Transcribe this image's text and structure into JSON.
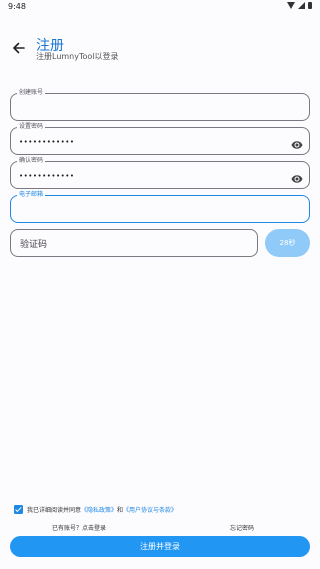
{
  "status_bar": {
    "time": "9:48"
  },
  "header": {
    "title": "注册",
    "subtitle": "注册LumnyTool以登录"
  },
  "form": {
    "account_label": "创建账号",
    "account_value": "",
    "password_label": "设置密码",
    "password_value": "••••••••••••",
    "confirm_label": "确认密码",
    "confirm_value": "••••••••••••",
    "email_label": "电子邮箱",
    "email_value": "",
    "code_placeholder": "验证码",
    "code_button": "28秒"
  },
  "agreement": {
    "checked": true,
    "prefix": "我已详细阅读并同意",
    "privacy": "《隐私政策》",
    "and": "和",
    "terms": "《用户协议与条款》"
  },
  "footer": {
    "login_link": "已有账号？点击登录",
    "forgot_link": "忘记密码",
    "submit": "注册并登录"
  },
  "colors": {
    "accent": "#1E88E5",
    "title": "#1976D2",
    "disabled_button": "#90CAF9"
  },
  "icons": {
    "back": "arrow-left-icon",
    "visibility": "eye-icon"
  }
}
